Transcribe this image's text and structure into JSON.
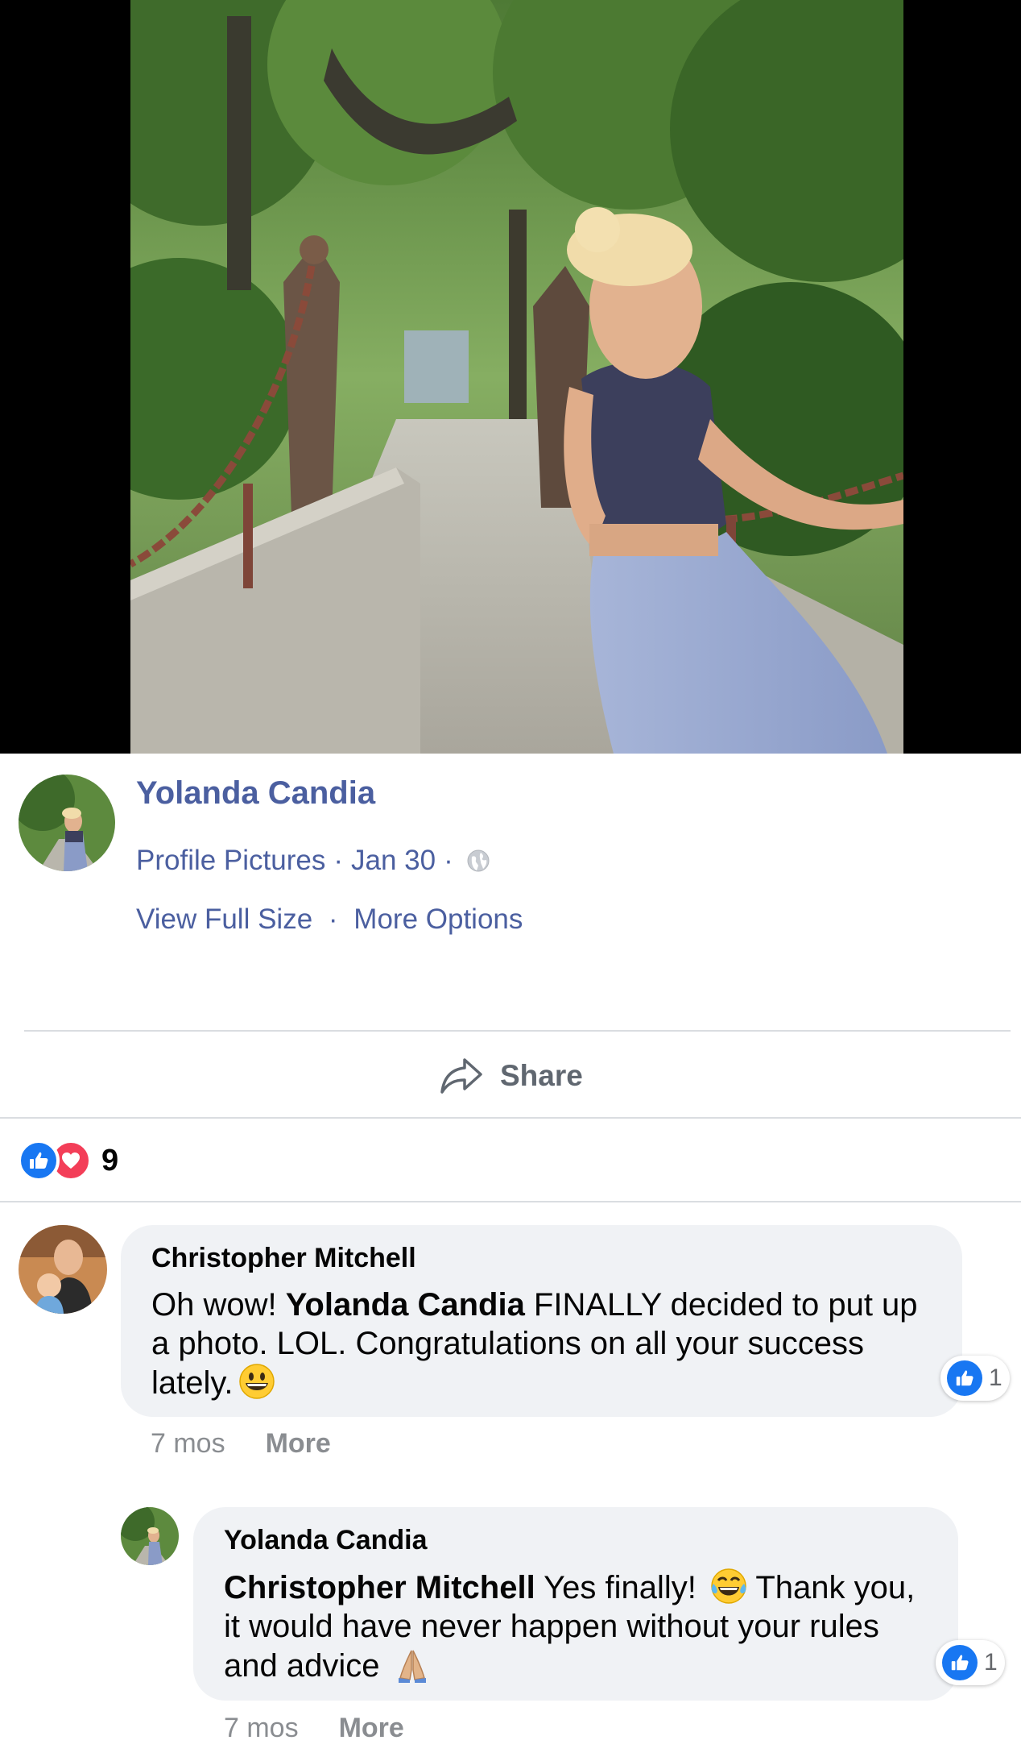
{
  "post": {
    "author": "Yolanda Candia",
    "album": "Profile Pictures",
    "date": "Jan 30",
    "separator": "·",
    "privacy_icon": "globe-icon",
    "actions": {
      "view_full_size": "View Full Size",
      "more_options": "More Options"
    },
    "photo_description_icon": "profile-photo"
  },
  "share": {
    "label": "Share",
    "icon": "share-arrow-icon"
  },
  "reactions": {
    "types": [
      "like",
      "love"
    ],
    "count": "9"
  },
  "comments": [
    {
      "author": "Christopher Mitchell",
      "text_prefix": "Oh wow! ",
      "mention": "Yolanda Candia",
      "text_suffix": " FINALLY decided to put up a photo. LOL. Congratulations on all your success lately.",
      "emoji": "grinning-face",
      "reaction_count": "1",
      "time": "7 mos",
      "more_label": "More"
    },
    {
      "author": "Yolanda Candia",
      "mention": "Christopher Mitchell",
      "text_a": " Yes finally! ",
      "emoji_a": "tears-of-joy",
      "text_b": " Thank you, it would have never happen without your rules and advice ",
      "emoji_b": "folded-hands",
      "reaction_count": "1",
      "time": "7 mos",
      "more_label": "More"
    }
  ],
  "colors": {
    "link_blue": "#4b5fa0",
    "like_blue": "#1877f2",
    "love_red": "#f33e58",
    "bubble_gray": "#f0f2f5",
    "muted_text": "#8a8d91"
  }
}
